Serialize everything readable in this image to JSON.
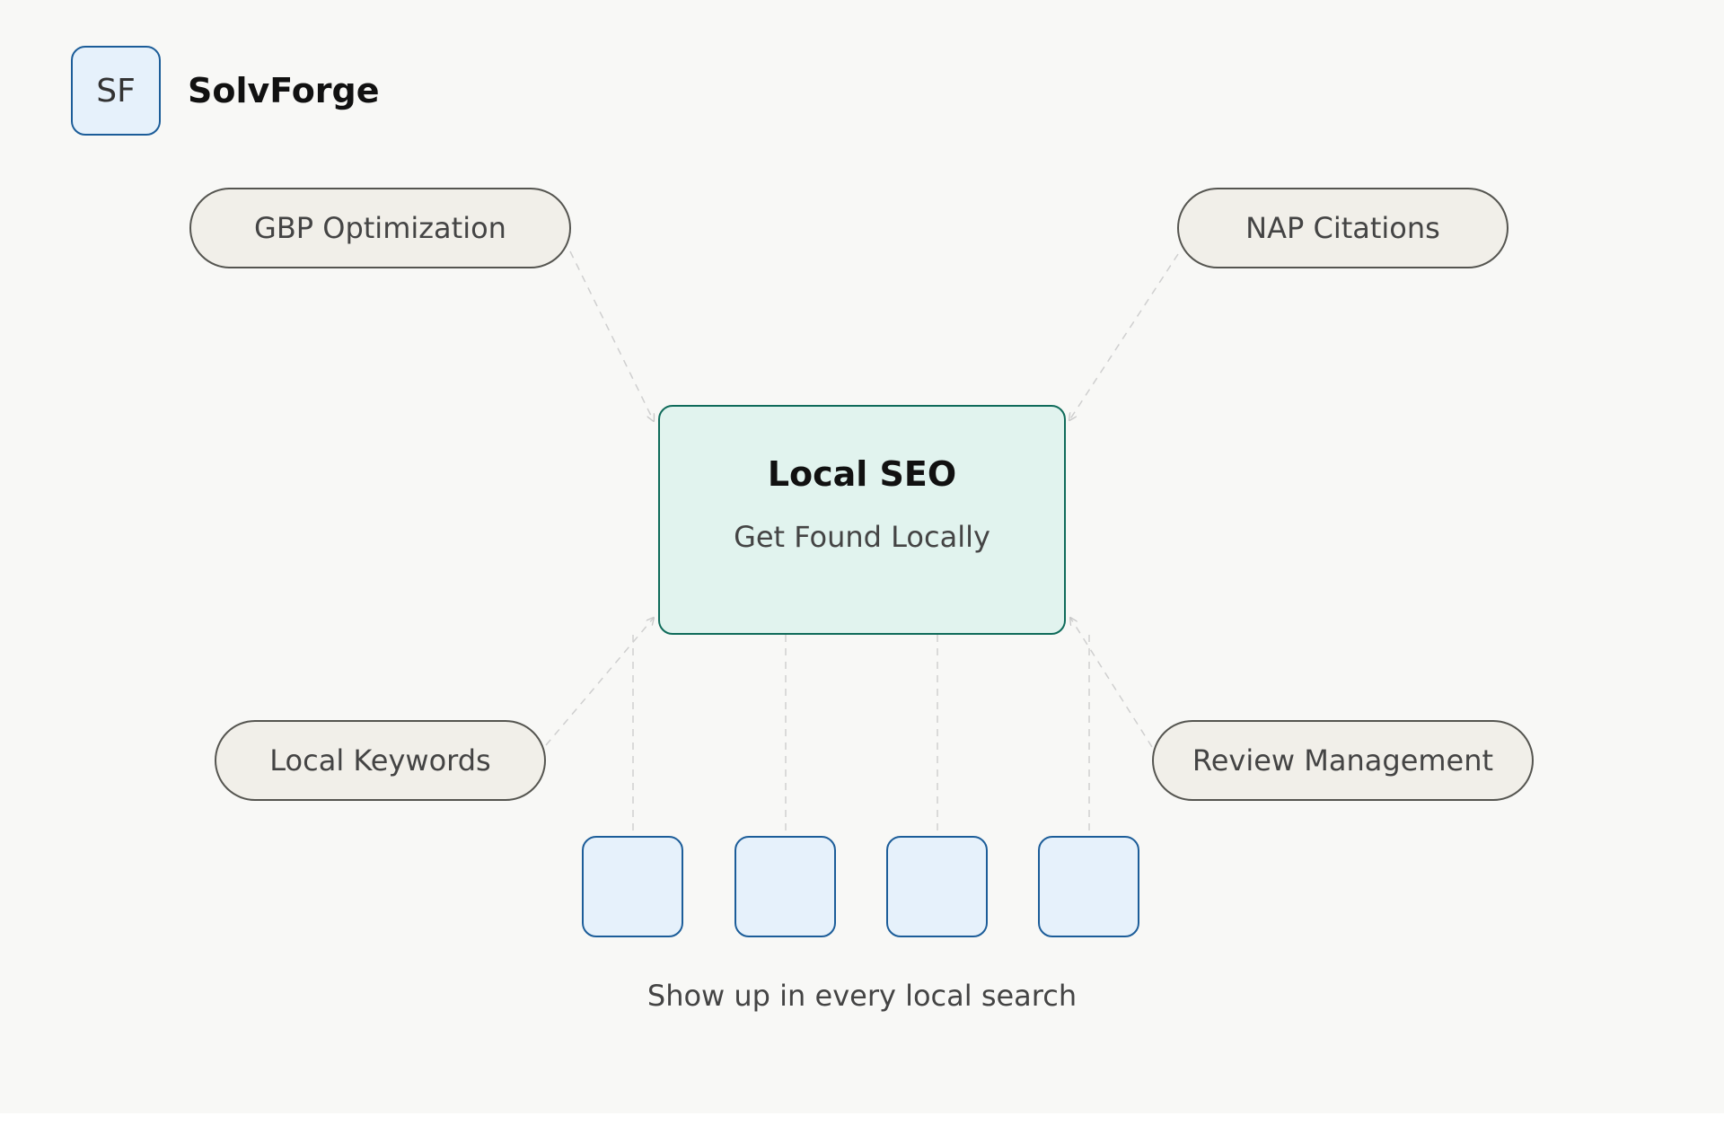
{
  "brand": {
    "logo_text": "SF",
    "name": "SolvForge"
  },
  "center": {
    "title": "Local SEO",
    "subtitle": "Get Found Locally"
  },
  "nodes": [
    {
      "label": "GBP Optimization"
    },
    {
      "label": "NAP Citations"
    },
    {
      "label": "Local Keywords"
    },
    {
      "label": "Review Management"
    }
  ],
  "tiles_count": 4,
  "caption": "Show up in every local search",
  "colors": {
    "background": "#f8f8f6",
    "accent_blue": "#1c5d99",
    "accent_blue_fill": "#e6f1fb",
    "accent_teal": "#0f6b5a",
    "accent_teal_fill": "#e1f3ee",
    "pill_fill": "#f1efe9",
    "connector": "#cfcfcf"
  }
}
